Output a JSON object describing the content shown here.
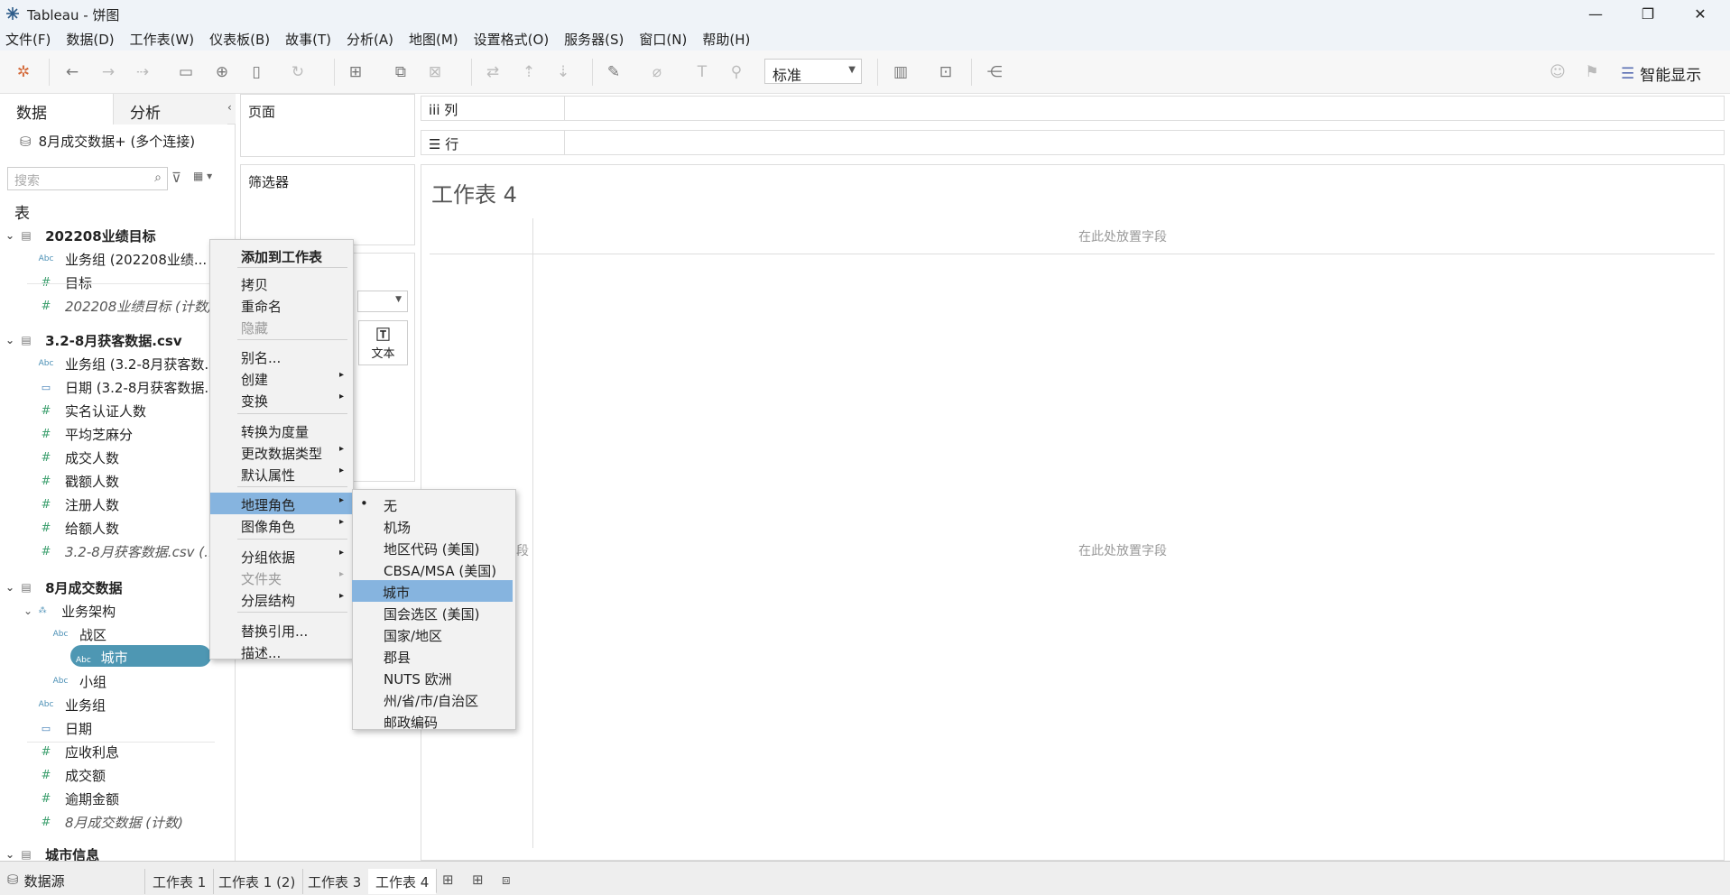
{
  "window": {
    "title": "Tableau - 饼图",
    "minimize": "—",
    "maximize": "❐",
    "close": "✕"
  },
  "menu": [
    "文件(F)",
    "数据(D)",
    "工作表(W)",
    "仪表板(B)",
    "故事(T)",
    "分析(A)",
    "地图(M)",
    "设置格式(O)",
    "服务器(S)",
    "窗口(N)",
    "帮助(H)"
  ],
  "toolbar": {
    "fit_select": "标准",
    "smart_label": "智能显示"
  },
  "left": {
    "tab_data": "数据",
    "tab_analysis": "分析",
    "connection": "8月成交数据+ (多个连接)",
    "search_placeholder": "搜索",
    "tables_header": "表",
    "fields": [
      {
        "t": "table",
        "label": "202208业绩目标"
      },
      {
        "t": "abc",
        "label": "业务组 (202208业绩..."
      },
      {
        "t": "hash",
        "label": "目标"
      },
      {
        "t": "hash-it",
        "label": "202208业绩目标 (计数)"
      },
      {
        "t": "table",
        "label": "3.2-8月获客数据.csv"
      },
      {
        "t": "abc",
        "label": "业务组 (3.2-8月获客数..."
      },
      {
        "t": "cal",
        "label": "日期 (3.2-8月获客数据..."
      },
      {
        "t": "hash",
        "label": "实名认证人数"
      },
      {
        "t": "hash",
        "label": "平均芝麻分"
      },
      {
        "t": "hash",
        "label": "成交人数"
      },
      {
        "t": "hash",
        "label": "戳额人数"
      },
      {
        "t": "hash",
        "label": "注册人数"
      },
      {
        "t": "hash",
        "label": "给额人数"
      },
      {
        "t": "hash-it",
        "label": "3.2-8月获客数据.csv (..."
      },
      {
        "t": "table",
        "label": "8月成交数据"
      },
      {
        "t": "hier",
        "label": "业务架构"
      },
      {
        "t": "abc2",
        "label": "战区"
      },
      {
        "t": "abc2",
        "label": "城市"
      },
      {
        "t": "abc2",
        "label": "小组"
      },
      {
        "t": "abc",
        "label": "业务组"
      },
      {
        "t": "cal",
        "label": "日期"
      },
      {
        "t": "hash",
        "label": "应收利息"
      },
      {
        "t": "hash",
        "label": "成交额"
      },
      {
        "t": "hash",
        "label": "逾期金额"
      },
      {
        "t": "hash-it",
        "label": "8月成交数据 (计数)"
      },
      {
        "t": "table",
        "label": "城市信息"
      }
    ]
  },
  "shelves": {
    "pages": "页面",
    "filters": "筛选器",
    "columns": "列",
    "rows": "行",
    "text_card": "文本"
  },
  "sheet": {
    "title": "工作表 4",
    "drop_field_top": "在此处放置字段",
    "drop_field_mid": "在此处放置字段",
    "drop_field_left": "段"
  },
  "context_menu": {
    "items": [
      "添加到工作表",
      "拷贝",
      "重命名",
      "隐藏",
      "别名...",
      "创建",
      "变换",
      "转换为度量",
      "更改数据类型",
      "默认属性",
      "地理角色",
      "图像角色",
      "分组依据",
      "文件夹",
      "分层结构",
      "替换引用...",
      "描述..."
    ]
  },
  "geo_menu": {
    "bullet": "•",
    "items": [
      "无",
      "机场",
      "地区代码 (美国)",
      "CBSA/MSA (美国)",
      "城市",
      "国会选区 (美国)",
      "国家/地区",
      "郡县",
      "NUTS 欧洲",
      "州/省/市/自治区",
      "邮政编码"
    ]
  },
  "bottom": {
    "datasource": "数据源",
    "tabs": [
      "工作表 1",
      "工作表 1 (2)",
      "工作表 3",
      "工作表 4"
    ]
  },
  "colors": {
    "selection": "#4e97b3",
    "menu_highlight": "#86b4df",
    "measure": "#3ea06f",
    "dimension": "#4a8fb5"
  }
}
